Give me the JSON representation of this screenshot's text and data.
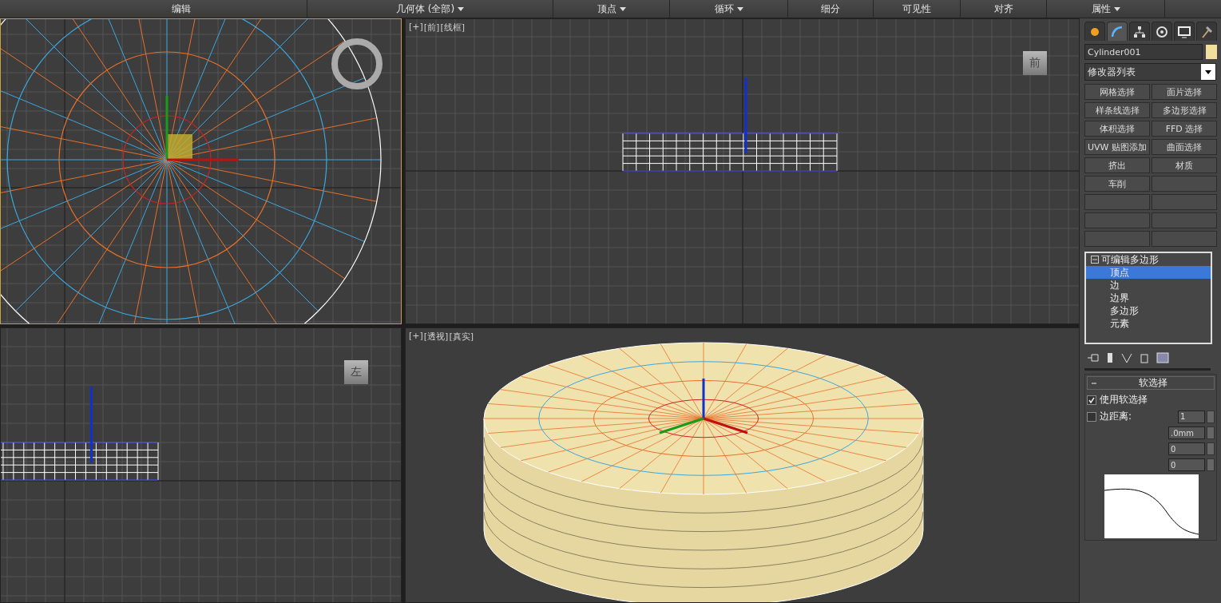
{
  "ribbon": [
    {
      "label": "编辑",
      "dropdown": false
    },
    {
      "label": "几何体 (全部)",
      "dropdown": true
    },
    {
      "label": "顶点",
      "dropdown": true
    },
    {
      "label": "循环",
      "dropdown": true
    },
    {
      "label": "细分",
      "dropdown": false
    },
    {
      "label": "可见性",
      "dropdown": false
    },
    {
      "label": "对齐",
      "dropdown": false
    },
    {
      "label": "属性",
      "dropdown": true
    }
  ],
  "viewports": [
    {
      "kind": "top",
      "active": true
    },
    {
      "kind": "front",
      "active": false,
      "labels": [
        "[+]",
        "[前]",
        "[线框]"
      ],
      "cube_label": "前"
    },
    {
      "kind": "left",
      "active": false,
      "cube_label": "左"
    },
    {
      "kind": "perspective",
      "active": false,
      "labels": [
        "[+]",
        "[透视]",
        "[真实]"
      ]
    }
  ],
  "command_panel": {
    "tabs": [
      {
        "kind": "create",
        "selected": false
      },
      {
        "kind": "modify",
        "selected": true
      },
      {
        "kind": "hierarchy",
        "selected": false
      },
      {
        "kind": "motion",
        "selected": false
      },
      {
        "kind": "display",
        "selected": false
      },
      {
        "kind": "utilities",
        "selected": false
      }
    ],
    "object_name": "Cylinder001",
    "modifier_list": "修改器列表",
    "modifier_buttons": [
      "网格选择",
      "面片选择",
      "样条线选择",
      "多边形选择",
      "体积选择",
      "FFD 选择",
      "UVW 贴图添加",
      "曲面选择",
      "挤出",
      "材质",
      "车削"
    ],
    "stack": {
      "label": "可编辑多边形",
      "expanded": true,
      "selected": false,
      "children": [
        {
          "label": "顶点",
          "selected": true
        },
        {
          "label": "边",
          "selected": false
        },
        {
          "label": "边界",
          "selected": false
        },
        {
          "label": "多边形",
          "selected": false
        },
        {
          "label": "元素",
          "selected": false
        }
      ]
    },
    "soft_selection": {
      "title": "软选择",
      "expanded": true,
      "use_soft_selection": {
        "label": "使用软选择",
        "checked": true
      },
      "edge_distance": {
        "label": "边距离:",
        "checked": false,
        "value": "1"
      },
      "spinners": [
        ".0mm",
        "0",
        "0"
      ]
    }
  }
}
